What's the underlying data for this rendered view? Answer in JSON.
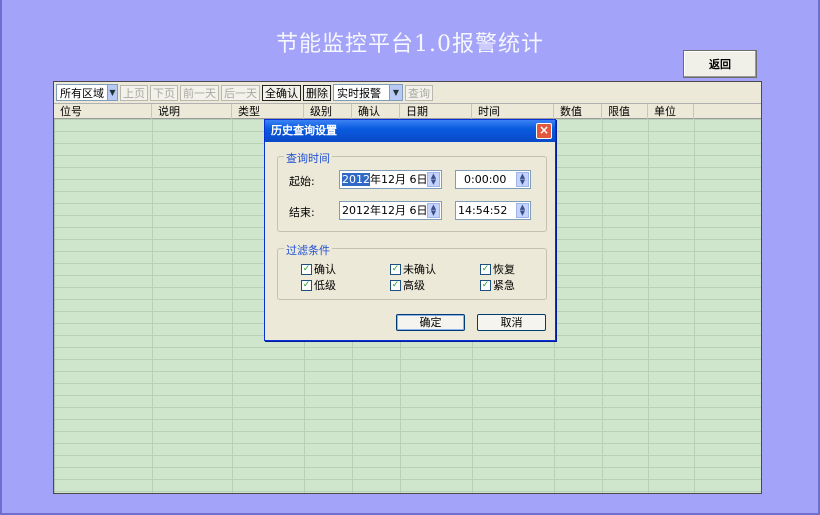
{
  "title": "节能监控平台1.0报警统计",
  "back_label": "返回",
  "toolbar": {
    "area_combo": "所有区域",
    "prev_page": "上页",
    "next_page": "下页",
    "prev_day": "前一天",
    "next_day": "后一天",
    "confirm_all": "全确认",
    "delete": "删除",
    "mode_combo": "实时报警",
    "query": "查询"
  },
  "columns": [
    "位号",
    "说明",
    "类型",
    "级别",
    "确认",
    "日期",
    "时间",
    "数值",
    "限值",
    "单位"
  ],
  "dialog": {
    "title": "历史查询设置",
    "close": "×",
    "time_group": "查询时间",
    "start_label": "起始:",
    "start_date_year": "2012",
    "start_date_rest": "年12月 6日",
    "start_time": "0:00:00",
    "end_label": "结束:",
    "end_date": "2012年12月 6日",
    "end_time": "14:54:52",
    "filter_group": "过滤条件",
    "filters": [
      {
        "label": "确认",
        "checked": true
      },
      {
        "label": "未确认",
        "checked": true
      },
      {
        "label": "恢复",
        "checked": true
      },
      {
        "label": "低级",
        "checked": true
      },
      {
        "label": "高级",
        "checked": true
      },
      {
        "label": "紧急",
        "checked": true
      }
    ],
    "ok": "确定",
    "cancel": "取消"
  },
  "icons": {
    "dropdown": "chevron-down-icon",
    "spin": "spin-updown-icon",
    "check": "checkmark-icon",
    "close": "close-icon"
  },
  "colors": {
    "background": "#a3a3f9",
    "grid": "#cfe6cc",
    "titlebar": "#0a5be0",
    "group_label": "#1f4fd6",
    "check": "#21a121"
  }
}
